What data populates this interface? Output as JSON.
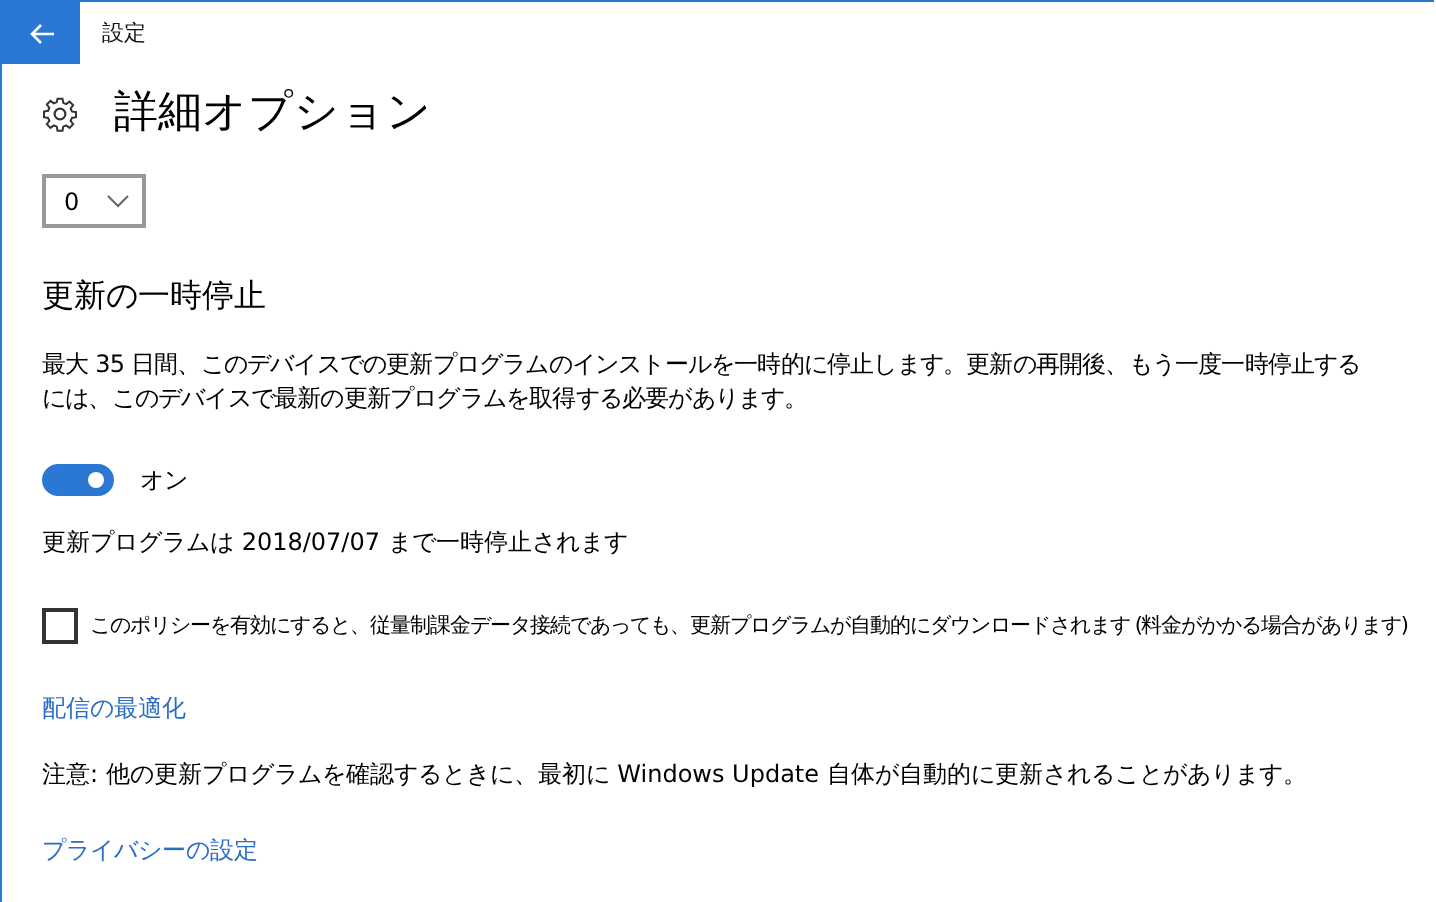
{
  "window": {
    "title": "設定"
  },
  "page": {
    "title": "詳細オプション"
  },
  "days_dropdown": {
    "value": "0"
  },
  "pause_section": {
    "heading": "更新の一時停止",
    "description": "最大 35 日間、このデバイスでの更新プログラムのインストールを一時的に停止します。更新の再開後、もう一度一時停止するには、このデバイスで最新の更新プログラムを取得する必要があります。",
    "toggle": {
      "on": true,
      "label": "オン"
    },
    "status": "更新プログラムは 2018/07/07 まで一時停止されます"
  },
  "metered_checkbox": {
    "checked": false,
    "label": "このポリシーを有効にすると、従量制課金データ接続であっても、更新プログラムが自動的にダウンロードされます (料金がかかる場合があります)"
  },
  "delivery_link": "配信の最適化",
  "note": "注意: 他の更新プログラムを確認するときに、最初に Windows Update 自体が自動的に更新されることがあります。",
  "privacy_link": "プライバシーの設定"
}
